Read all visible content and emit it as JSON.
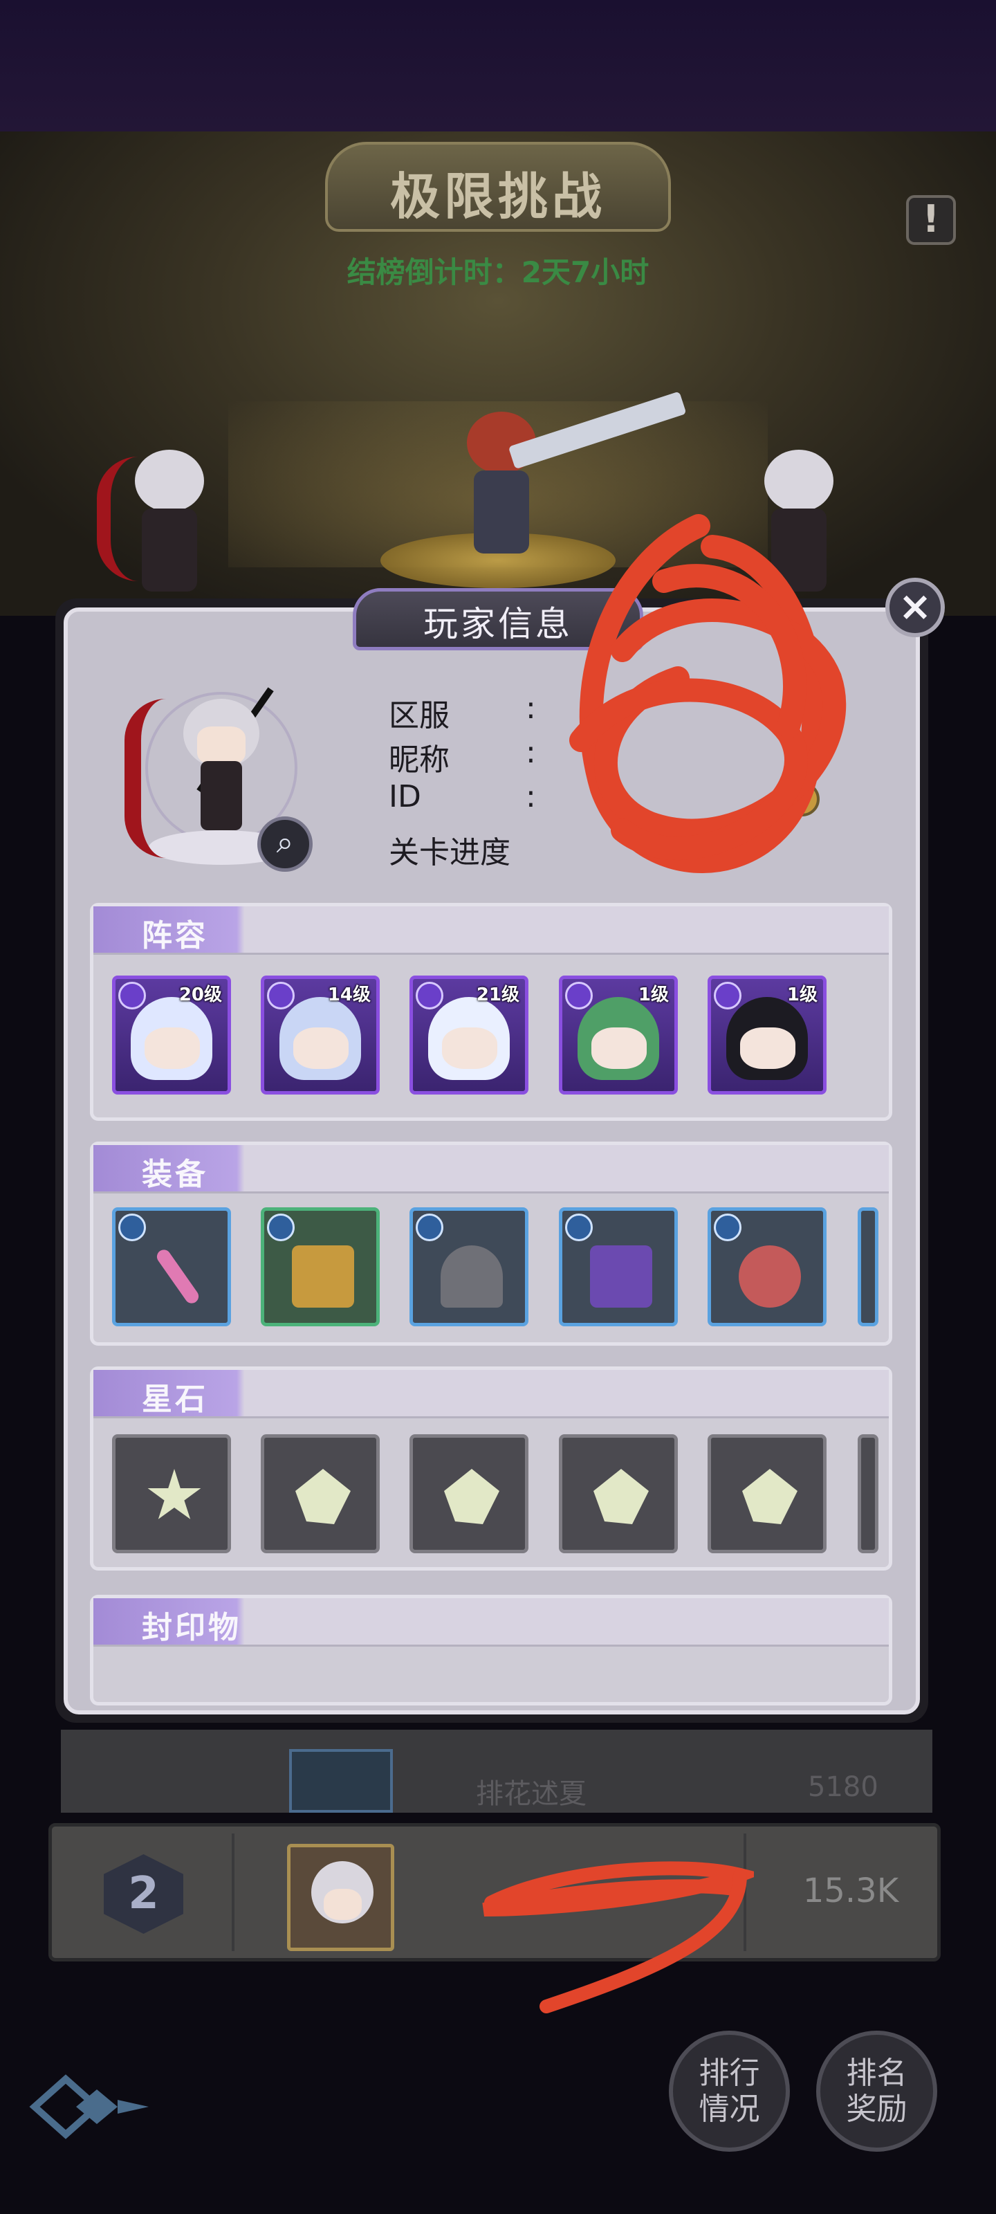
{
  "header": {
    "title": "极限挑战",
    "countdown": "结榜倒计时：2天7小时",
    "help_icon": "exclamation-icon"
  },
  "modal": {
    "title": "玩家信息",
    "close_icon": "close-icon",
    "info_labels": {
      "server": "区服",
      "nickname": "昵称",
      "id": "ID",
      "progress": "关卡进度"
    },
    "info_colon": ":",
    "search_icon": "magnifier-icon",
    "sections": {
      "lineup": "阵容",
      "equipment": "装备",
      "star_stone": "星石",
      "seal": "封印物"
    },
    "heroes": [
      {
        "level": "20级",
        "hair": "#dfe7ff",
        "badge": "sword-icon"
      },
      {
        "level": "14级",
        "hair": "#c9d6f5",
        "badge": "sword-icon"
      },
      {
        "level": "21级",
        "hair": "#eaf0ff",
        "badge": "staff-icon"
      },
      {
        "level": "1级",
        "hair": "#4f9f67",
        "badge": "sword-icon"
      },
      {
        "level": "1级",
        "hair": "#1c1b22",
        "badge": "swirl-icon"
      }
    ],
    "equipment": [
      {
        "name": "heart-staff-icon",
        "color": "#e07ab3"
      },
      {
        "name": "spellbook-icon",
        "color": "#c79a3e"
      },
      {
        "name": "witch-hat-icon",
        "color": "#6f7077"
      },
      {
        "name": "cloak-icon",
        "color": "#6b4ab0"
      },
      {
        "name": "ring-icon",
        "color": "#c45a5a"
      }
    ],
    "stones": [
      "star-stone-icon",
      "crystal-icon",
      "shield-gem-icon",
      "hex-gem-icon",
      "shard-gem-icon"
    ]
  },
  "leaderboard": {
    "row_rank": "2",
    "row_score": "15.3K",
    "partial_score": "5180",
    "partial_name": "排花述夏"
  },
  "buttons": {
    "ranking": "排行\n情况",
    "rewards": "排名\n奖励"
  },
  "colors": {
    "modal_bg": "#c4c1cc",
    "accent_purple": "#a38bd6",
    "countdown_green": "#3a8a44",
    "scribble_red": "#e2452b"
  }
}
